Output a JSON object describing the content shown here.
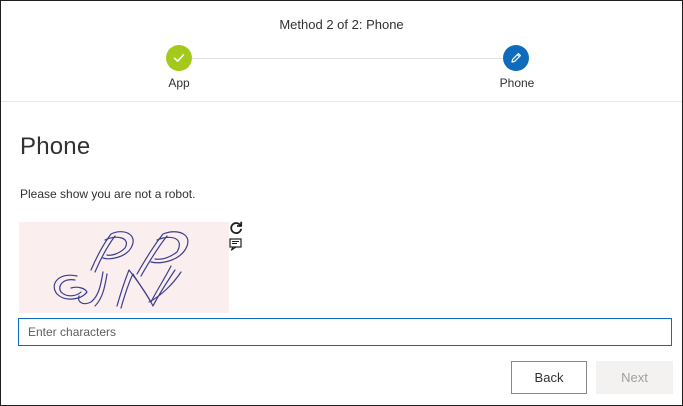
{
  "header": {
    "method_title": "Method 2 of 2: Phone",
    "steps": [
      {
        "label": "App",
        "state": "completed",
        "color": "#a4c91a",
        "icon": "checkmark-icon"
      },
      {
        "label": "Phone",
        "state": "current",
        "color": "#0f6cbd",
        "icon": "pencil-icon"
      }
    ]
  },
  "main": {
    "heading": "Phone",
    "instruction": "Please show you are not a robot.",
    "captcha": {
      "image_text": "PP GJN",
      "refresh_icon": "refresh-icon",
      "audio_icon": "audio-captcha-icon"
    },
    "input": {
      "placeholder": "Enter characters",
      "value": ""
    }
  },
  "footer": {
    "back_label": "Back",
    "next_label": "Next",
    "next_enabled": false
  },
  "colors": {
    "accent": "#0f6cbd",
    "success": "#a4c91a",
    "captcha_background": "#fbeeee"
  }
}
